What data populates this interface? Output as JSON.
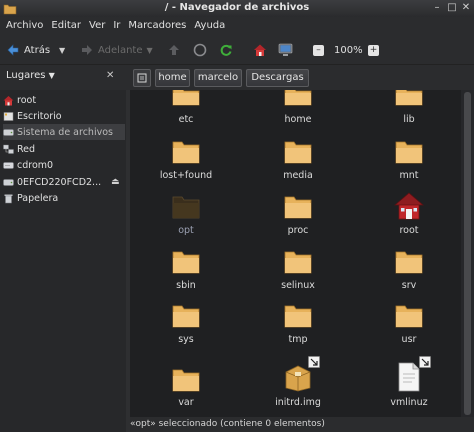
{
  "window": {
    "title": "/ - Navegador de archivos"
  },
  "menu": [
    "Archivo",
    "Editar",
    "Ver",
    "Ir",
    "Marcadores",
    "Ayuda"
  ],
  "toolbar": {
    "back": "Atrás",
    "forward": "Adelante",
    "zoom": "100%"
  },
  "location": {
    "places_label": "Lugares",
    "crumbs": [
      "home",
      "marcelo",
      "Descargas"
    ]
  },
  "sidebar": [
    {
      "label": "root",
      "icon": "home-icon"
    },
    {
      "label": "Escritorio",
      "icon": "desktop-icon"
    },
    {
      "label": "Sistema de archivos",
      "icon": "drive-icon",
      "selected": true
    },
    {
      "label": "Red",
      "icon": "network-icon"
    },
    {
      "label": "cdrom0",
      "icon": "cdrom-icon"
    },
    {
      "label": "0EFCD220FCD2...",
      "icon": "drive-icon",
      "ejectable": true
    },
    {
      "label": "Papelera",
      "icon": "trash-icon"
    }
  ],
  "files": [
    {
      "name": "etc",
      "type": "folder"
    },
    {
      "name": "home",
      "type": "folder"
    },
    {
      "name": "lib",
      "type": "folder"
    },
    {
      "name": "lost+found",
      "type": "folder"
    },
    {
      "name": "media",
      "type": "folder"
    },
    {
      "name": "mnt",
      "type": "folder"
    },
    {
      "name": "opt",
      "type": "folder-dark",
      "selected": true
    },
    {
      "name": "proc",
      "type": "folder"
    },
    {
      "name": "root",
      "type": "home"
    },
    {
      "name": "sbin",
      "type": "folder"
    },
    {
      "name": "selinux",
      "type": "folder"
    },
    {
      "name": "srv",
      "type": "folder"
    },
    {
      "name": "sys",
      "type": "folder"
    },
    {
      "name": "tmp",
      "type": "folder"
    },
    {
      "name": "usr",
      "type": "folder"
    },
    {
      "name": "var",
      "type": "folder"
    },
    {
      "name": "initrd.img",
      "type": "package-link"
    },
    {
      "name": "vmlinuz",
      "type": "file-link"
    }
  ],
  "status": {
    "text": "«opt» seleccionado (contiene 0 elementos)"
  },
  "colors": {
    "folder": "#e7b25b",
    "folder_dark": "#3a2e1c",
    "home_red": "#c0262a"
  }
}
